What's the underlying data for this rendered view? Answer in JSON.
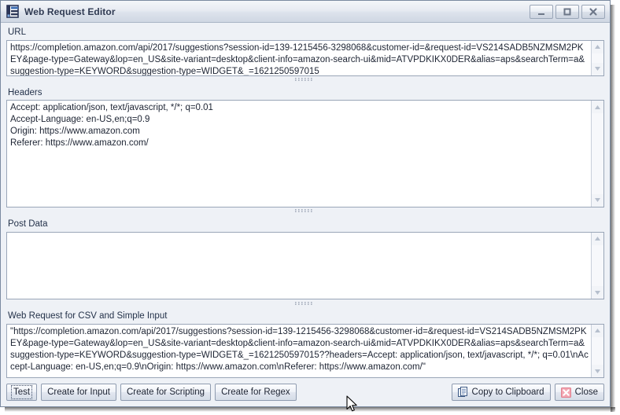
{
  "window": {
    "title": "Web Request Editor",
    "icon": "form-editor-icon",
    "controls": {
      "minimize": "minimize-button",
      "maximize": "maximize-button",
      "close": "close-button"
    }
  },
  "fields": {
    "url": {
      "label": "URL",
      "value": "https://completion.amazon.com/api/2017/suggestions?session-id=139-1215456-3298068&customer-id=&request-id=VS214SADB5NZMSM2PKEY&page-type=Gateway&lop=en_US&site-variant=desktop&client-info=amazon-search-ui&mid=ATVPDKIKX0DER&alias=aps&searchTerm=a&suggestion-type=KEYWORD&suggestion-type=WIDGET&_=1621250597015"
    },
    "headers": {
      "label": "Headers",
      "value": "Accept: application/json, text/javascript, */*; q=0.01\nAccept-Language: en-US,en;q=0.9\nOrigin: https://www.amazon.com\nReferer: https://www.amazon.com/"
    },
    "post_data": {
      "label": "Post Data",
      "value": ""
    },
    "web_request": {
      "label": "Web Request for CSV and Simple Input",
      "value": "\"https://completion.amazon.com/api/2017/suggestions?session-id=139-1215456-3298068&customer-id=&request-id=VS214SADB5NZMSM2PKEY&page-type=Gateway&lop=en_US&site-variant=desktop&client-info=amazon-search-ui&mid=ATVPDKIKX0DER&alias=aps&searchTerm=a&suggestion-type=KEYWORD&suggestion-type=WIDGET&_=1621250597015??headers=Accept: application/json, text/javascript, */*; q=0.01\\nAccept-Language: en-US,en;q=0.9\\nOrigin: https://www.amazon.com\\nReferer: https://www.amazon.com/\""
    }
  },
  "buttons": {
    "test": "Test",
    "create_for_input": "Create for Input",
    "create_for_scripting": "Create for Scripting",
    "create_for_regex": "Create for Regex",
    "copy_to_clipboard": "Copy to Clipboard",
    "close": "Close"
  },
  "icons": {
    "copy": "clipboard-icon",
    "close": "red-x-icon",
    "scroll_up": "scroll-up-arrow-icon",
    "scroll_down": "scroll-down-arrow-icon",
    "splitter": "splitter-grip-icon",
    "cursor": "mouse-pointer-icon"
  },
  "colors": {
    "accent": "#2f3a52",
    "window_bg": "#eef1f6",
    "field_bg": "#ffffff",
    "border": "#9aa6b8",
    "close_icon": "#e87b8c"
  }
}
